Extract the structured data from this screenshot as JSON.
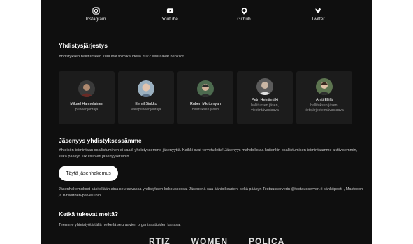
{
  "social": [
    {
      "label": "Instagram",
      "icon": "instagram-icon"
    },
    {
      "label": "Youtube",
      "icon": "youtube-icon"
    },
    {
      "label": "Github",
      "icon": "github-icon"
    },
    {
      "label": "Twitter",
      "icon": "twitter-icon"
    }
  ],
  "board": {
    "title": "Yhdistysjärjestys",
    "intro": "Yhdistyksen hallitukseen kuuluvat toimikaudella 2022 seuraavat henkilöt:",
    "members": [
      {
        "name": "Mikael Hannolainen",
        "role": "puheenjohtaja"
      },
      {
        "name": "Eemil Sinkko",
        "role": "varapuheenjohtaja"
      },
      {
        "name": "Ruben Mkrtumyan",
        "role": "hallituksen jäsen"
      },
      {
        "name": "Petri Heinämäki",
        "role": "hallituksen jäsen, viestintävastaava"
      },
      {
        "name": "Antti Ellilä",
        "role": "hallituksen jäsen, tietojärjestelmävastaava"
      }
    ]
  },
  "membership": {
    "title": "Jäsenyys yhdistyksessämme",
    "text": "Yhteisön toimintaan osallistuminen ei vaadi yhdistyksemme jäsenyyttä. Kaikki ovat tervetulleita! Jäsenyys mahdollistaa kuitenkin osallistumisen toimintaamme aktiivisemmin, sekä pääsyn lukuisiin eri jäsenyysetuihin.",
    "button": "Täytä jäsenhakemus",
    "note": "Jäsenhakemukset käsitellään aina seuraavassa yhdistyksen kokouksessa. Jäsenenä saa äänioikeuden, sekä pääsyn Testausserverin @testausserveri.fi sähköposti-, Mastodon- ja BitWarden-palveluihin."
  },
  "supporters": {
    "title": "Ketkä tukevat meitä?",
    "text": "Teemme yhteistyötä tällä hetkellä seuraavien organisaatioiden kanssa:",
    "logos": [
      "RTIZ",
      "WOMEN",
      "POLICA"
    ]
  }
}
